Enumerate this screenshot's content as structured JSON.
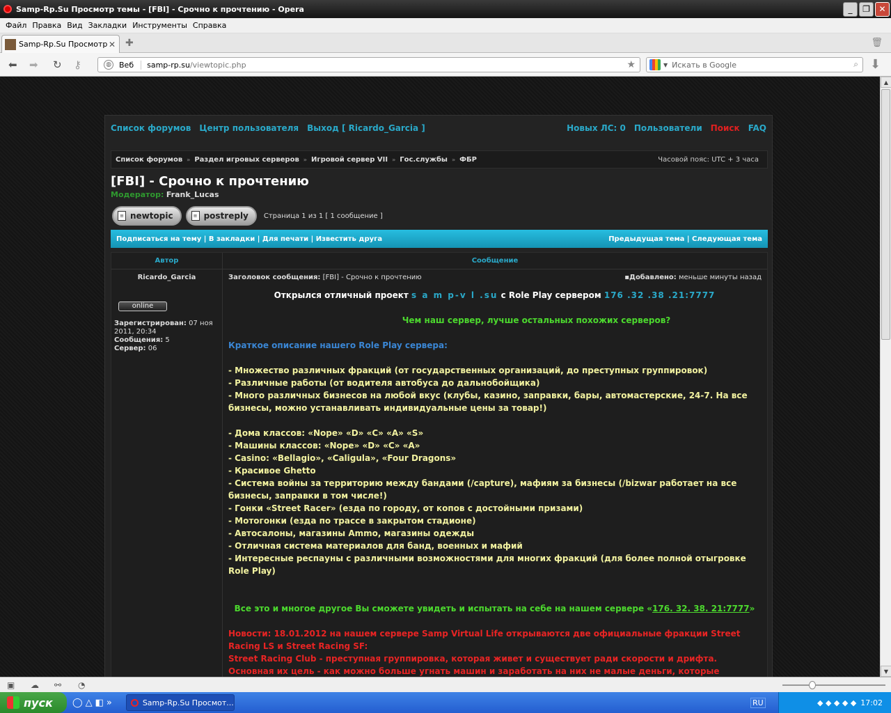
{
  "window": {
    "title": "Samp-Rp.Su Просмотр темы - [FBI] - Срочно к прочтению - Opera"
  },
  "menu": [
    "Файл",
    "Правка",
    "Вид",
    "Закладки",
    "Инструменты",
    "Справка"
  ],
  "tab": {
    "label": "Samp-Rp.Su Просмотр т..."
  },
  "address": {
    "scheme_label": "Веб",
    "host": "samp-rp.su",
    "path": "/viewtopic.php"
  },
  "search": {
    "placeholder": "Искать в Google"
  },
  "forum": {
    "nav_left": [
      "Список форумов",
      "Центр пользователя",
      "Выход [ Ricardo_Garcia ]"
    ],
    "nav_right": [
      "Новых ЛС: 0",
      "Пользователи",
      "Поиск",
      "FAQ"
    ],
    "breadcrumbs": [
      "Список форумов",
      "Раздел игровых серверов",
      "Игровой сервер VII",
      "Гос.службы",
      "ФБР"
    ],
    "timezone": "Часовой пояс: UTC + 3 часа",
    "topic_title": "[FBI] - Срочно к прочтению",
    "moderator_label": "Модератор:",
    "moderator_name": "Frank_Lucas",
    "btn_new": "newtopic",
    "btn_reply": "postreply",
    "page_info": "Страница 1 из 1 [ 1 сообщение ]",
    "actions_left": "Подписаться на тему | В закладки | Для печати | Известить друга",
    "actions_right": "Предыдущая тема | Следующая тема",
    "col_author": "Автор",
    "col_message": "Сообщение",
    "author": "Ricardo_Garcia",
    "online": "online",
    "registered_label": "Зарегистрирован:",
    "registered_value": "07 ноя 2011, 20:34",
    "posts_label": "Сообщения:",
    "posts_value": "5",
    "server_label": "Сервер:",
    "server_value": "06",
    "subject_label": "Заголовок сообщения:",
    "subject_value": "[FBI] - Срочно к прочтению",
    "added_label": "Добавлено:",
    "added_value": "меньше минуты назад",
    "post": {
      "line1_a": "Открылся отличный проект ",
      "line1_site": "s a m p-v l .su",
      "line1_b": " с Role Play сервером ",
      "line1_ip": "176 .32 .38 .21:7777",
      "line2": "Чем наш сервер, лучше остальных похожих серверов?",
      "heading": "Краткое описание нашего Role Play сервера:",
      "items1": [
        "- Множество различных фракций (от государственных организаций, до преступных группировок)",
        "- Различные работы (от водителя автобуса до дальнобойщика)",
        "- Много различных бизнесов на любой вкус (клубы, казино, заправки, бары, автомастерские, 24-7. На все бизнесы, можно устанавливать индивидуальные цены за товар!)"
      ],
      "items2": [
        "- Дома классов: «Nope» «D» «C» «A» «S»",
        "- Машины классов: «Nope» «D» «C» «A»",
        "- Casino: «Bellagio», «Caligula», «Four Dragons»",
        "- Красивое Ghetto",
        "- Система войны за территорию между бандами (/capture), мафиям за бизнесы (/bizwar работает на все бизнесы, заправки в том числе!)",
        "- Гонки «Street Racer» (езда по городу, от копов с достойными призами)",
        "- Мотогонки (езда по трассе в закрытом стадионе)",
        "- Автосалоны, магазины Ammo, магазины одежды",
        "- Отличная система материалов для банд, военных и мафий",
        "- Интересные респауны с различными возможностями для многих фракций (для более полной отыгровке Role Play)"
      ],
      "closing_a": "Все это и многое другое Вы сможете увидеть и испытать на себе на нашем сервере «",
      "closing_ip": "176. 32. 38. 21:7777",
      "closing_b": "»",
      "news": "Новости: 18.01.2012 на нашем сервере Samp Virtual Life открываются две официальные фракции Street Racing LS и Street Racing SF:",
      "news2": "Street Racing Club - преступная группировка, которая живет и существует ради скорости и дрифта. Основная их цель - как можно больше угнать машин и заработать на них не малые деньги, которые необходимо вложить на покупку личных авто и их тюнинг. Это позволит участвовать в соревнованиях и выигрывать огромные ставки своих"
    }
  },
  "taskbar": {
    "start": "пуск",
    "task": "Samp-Rp.Su Просмот...",
    "lang": "RU",
    "clock": "17:02"
  },
  "colors": {
    "accent": "#2aa9c9",
    "bar": "#1593b4",
    "green": "#4cd92e",
    "red": "#e82424",
    "yellow": "#f2f2a0"
  }
}
